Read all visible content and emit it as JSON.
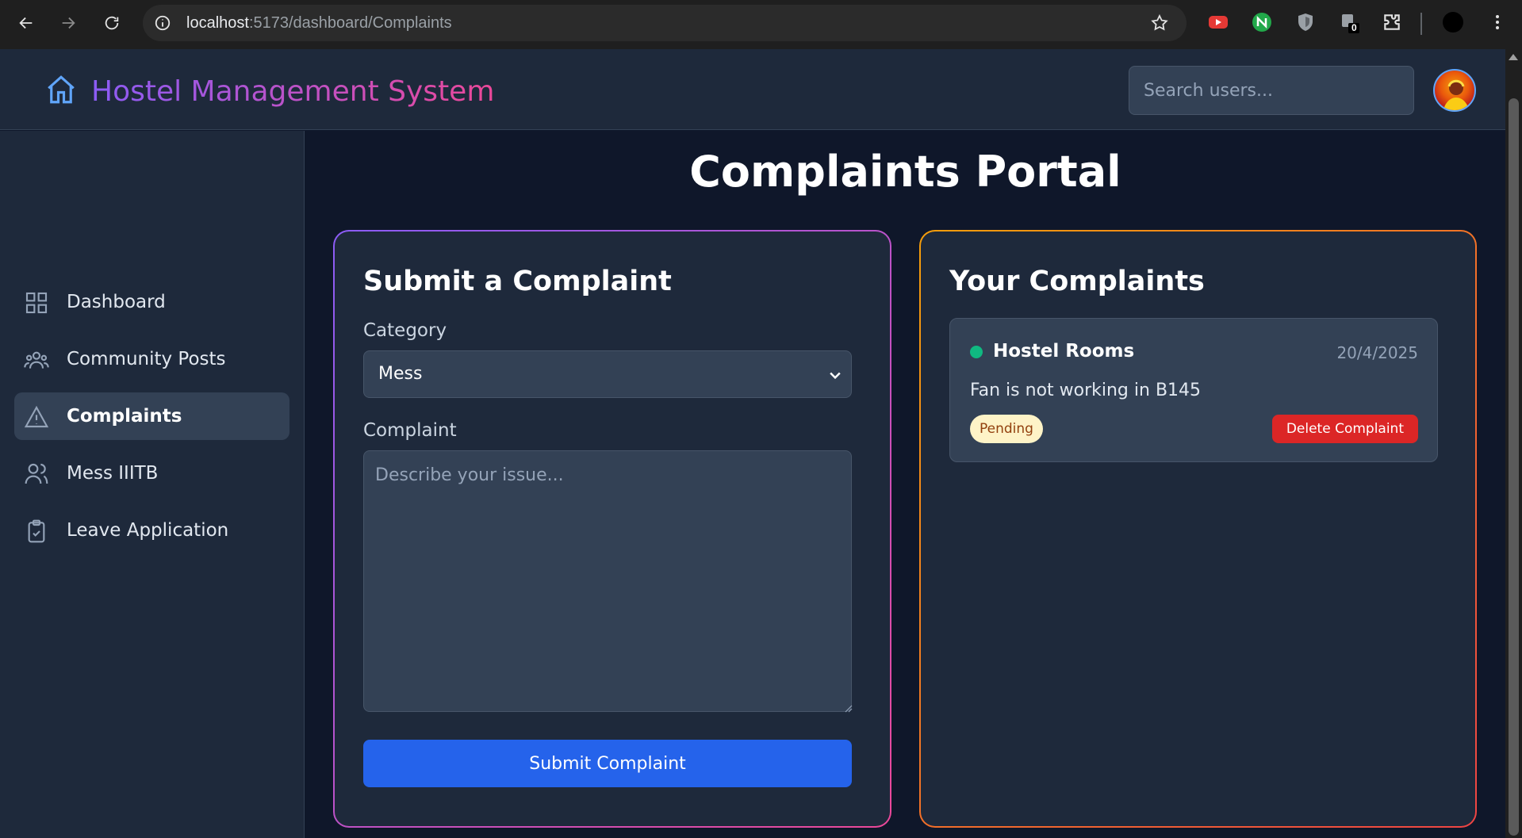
{
  "browser": {
    "url_host": "localhost",
    "url_path": ":5173/dashboard/Complaints",
    "extension_badge": "0"
  },
  "header": {
    "title": "Hostel Management System",
    "search_placeholder": "Search users..."
  },
  "sidebar": {
    "items": [
      {
        "label": "Dashboard",
        "icon": "grid-icon",
        "active": false
      },
      {
        "label": "Community Posts",
        "icon": "users-group-icon",
        "active": false
      },
      {
        "label": "Complaints",
        "icon": "warning-triangle-icon",
        "active": true
      },
      {
        "label": "Mess IIITB",
        "icon": "two-users-icon",
        "active": false
      },
      {
        "label": "Leave Application",
        "icon": "clipboard-check-icon",
        "active": false
      }
    ]
  },
  "main": {
    "page_title": "Complaints Portal",
    "submit_form": {
      "heading": "Submit a Complaint",
      "category_label": "Category",
      "category_value": "Mess",
      "complaint_label": "Complaint",
      "complaint_placeholder": "Describe your issue...",
      "submit_label": "Submit Complaint"
    },
    "your_complaints": {
      "heading": "Your Complaints",
      "items": [
        {
          "category": "Hostel Rooms",
          "date": "20/4/2025",
          "text": "Fan is not working in B145",
          "status": "Pending",
          "delete_label": "Delete Complaint"
        }
      ]
    }
  },
  "colors": {
    "accent_blue": "#2563eb",
    "danger": "#dc2626",
    "status_dot": "#10b981",
    "pending_bg": "#fef3c7"
  }
}
